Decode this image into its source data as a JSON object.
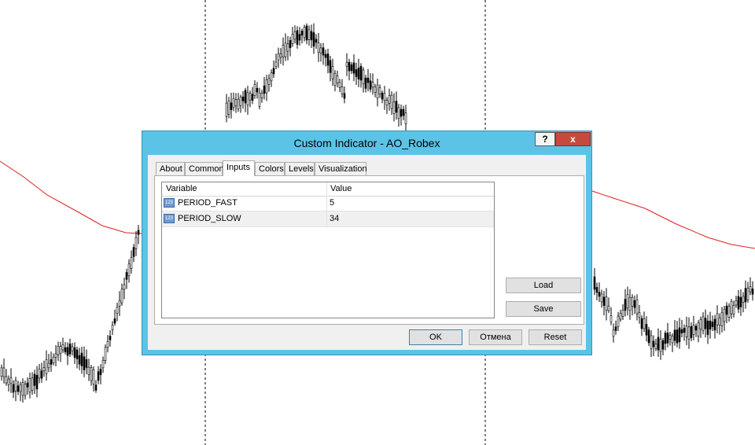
{
  "window": {
    "title": "Custom Indicator - AO_Robex",
    "help_label": "?",
    "close_label": "x"
  },
  "tabs": [
    {
      "label": "About",
      "active": false
    },
    {
      "label": "Common",
      "active": false
    },
    {
      "label": "Inputs",
      "active": true
    },
    {
      "label": "Colors",
      "active": false
    },
    {
      "label": "Levels",
      "active": false
    },
    {
      "label": "Visualization",
      "active": false
    }
  ],
  "grid": {
    "headers": [
      "Variable",
      "Value"
    ],
    "rows": [
      {
        "icon": "123-icon",
        "name": "PERIOD_FAST",
        "value": "5"
      },
      {
        "icon": "123-icon",
        "name": "PERIOD_SLOW",
        "value": "34"
      }
    ]
  },
  "side_buttons": {
    "load": "Load",
    "save": "Save"
  },
  "footer": {
    "ok": "OK",
    "cancel": "Отмена",
    "reset": "Reset"
  },
  "colors": {
    "ma_line": "#e02020",
    "title_bar": "#5bc4e6",
    "close_button": "#c6493d"
  }
}
